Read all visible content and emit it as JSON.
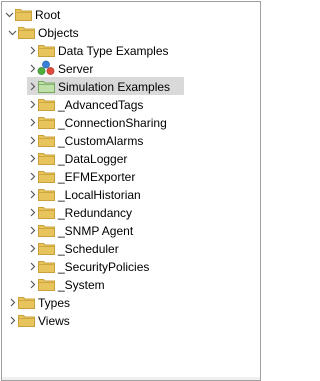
{
  "tree": {
    "root": {
      "label": "Root"
    },
    "objects": {
      "label": "Objects",
      "children": [
        {
          "label": "Data Type Examples",
          "icon": "folder-icon"
        },
        {
          "label": "Server",
          "icon": "server-icon"
        },
        {
          "label": "Simulation Examples",
          "icon": "folder-green-icon",
          "selected": true
        },
        {
          "label": "_AdvancedTags",
          "icon": "folder-icon"
        },
        {
          "label": "_ConnectionSharing",
          "icon": "folder-icon"
        },
        {
          "label": "_CustomAlarms",
          "icon": "folder-icon"
        },
        {
          "label": "_DataLogger",
          "icon": "folder-icon"
        },
        {
          "label": "_EFMExporter",
          "icon": "folder-icon"
        },
        {
          "label": "_LocalHistorian",
          "icon": "folder-icon"
        },
        {
          "label": "_Redundancy",
          "icon": "folder-icon"
        },
        {
          "label": "_SNMP Agent",
          "icon": "folder-icon"
        },
        {
          "label": "_Scheduler",
          "icon": "folder-icon"
        },
        {
          "label": "_SecurityPolicies",
          "icon": "folder-icon"
        },
        {
          "label": "_System",
          "icon": "folder-icon"
        }
      ]
    },
    "types": {
      "label": "Types"
    },
    "views": {
      "label": "Views"
    }
  },
  "colors": {
    "folder": "#e8c45c",
    "folder_dark": "#c9a13a",
    "folder_green": "#bfe0a8",
    "selection": "#d9d9d9",
    "twisty": "#595959"
  }
}
